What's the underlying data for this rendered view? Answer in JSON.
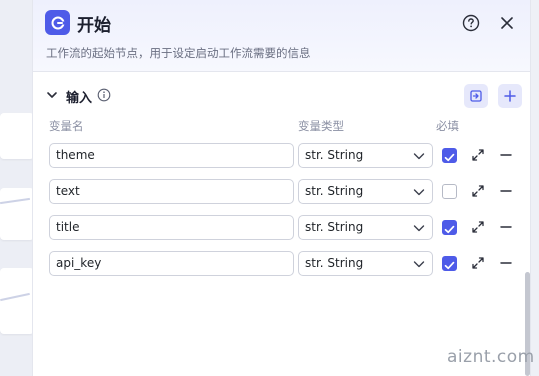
{
  "header": {
    "title": "开始",
    "description": "工作流的起始节点，用于设定启动工作流需要的信息"
  },
  "inputs_section": {
    "title": "输入",
    "columns": {
      "name": "变量名",
      "type": "变量类型",
      "required": "必填"
    },
    "rows": [
      {
        "name": "theme",
        "type": "str. String",
        "required": true
      },
      {
        "name": "text",
        "type": "str. String",
        "required": false
      },
      {
        "name": "title",
        "type": "str. String",
        "required": true
      },
      {
        "name": "api_key",
        "type": "str. String",
        "required": true
      }
    ]
  },
  "colors": {
    "accent": "#4e5be8",
    "accent_soft": "#e6e8fb"
  },
  "icons": {
    "app": "workflow-start-icon",
    "help": "question-circle-icon",
    "close": "close-icon",
    "collapse": "chevron-down-icon",
    "info": "info-icon",
    "import": "import-icon",
    "add": "plus-icon",
    "expand": "expand-arrows-icon",
    "remove": "minus-icon"
  },
  "watermark": "aiznt.com"
}
